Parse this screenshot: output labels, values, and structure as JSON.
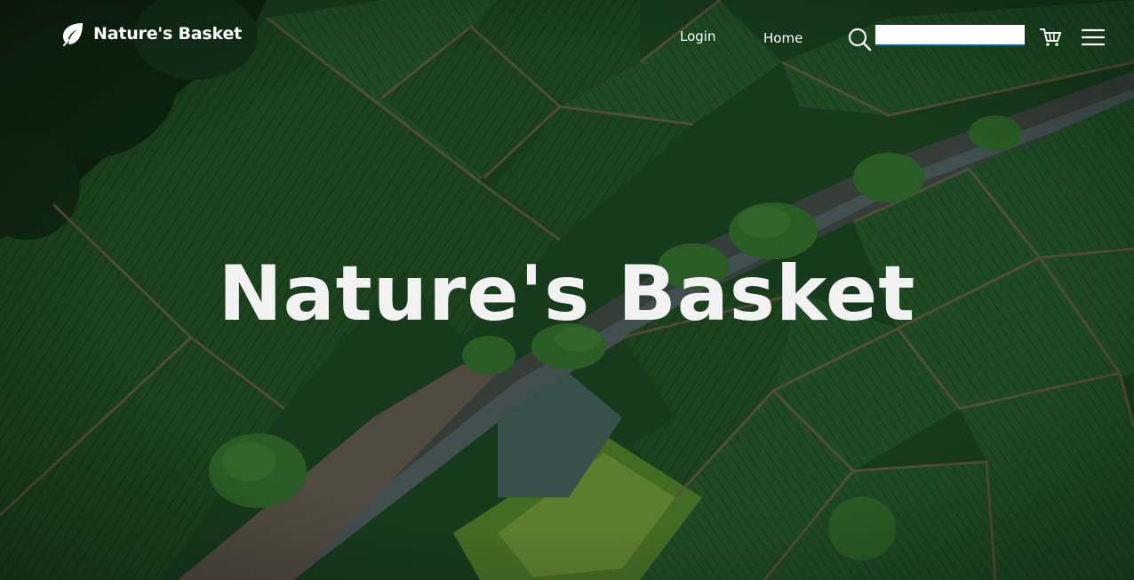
{
  "brand": {
    "name": "Nature's Basket",
    "logo_icon": "leaf-icon"
  },
  "nav": {
    "login_label": "Login",
    "home_label": "Home"
  },
  "search": {
    "icon": "search-icon",
    "value": "",
    "placeholder": ""
  },
  "cart": {
    "icon": "cart-icon"
  },
  "menu": {
    "icon": "hamburger-menu-icon"
  },
  "hero": {
    "title": "Nature's Basket",
    "background": "aerial-farm-fields-image"
  },
  "colors": {
    "text": "#ffffff",
    "hero_text": "#f2f2f2",
    "field_dark": "#173a1b",
    "field_mid": "#245a26",
    "search_underline": "#0b5cad"
  }
}
